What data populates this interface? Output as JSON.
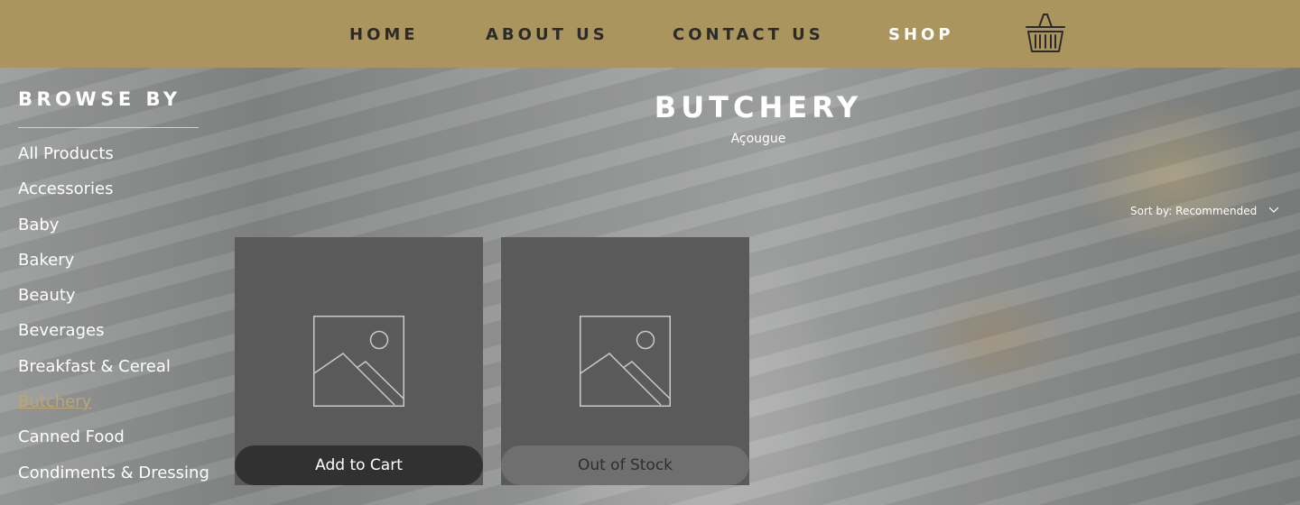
{
  "header": {
    "nav": [
      {
        "label": "HOME"
      },
      {
        "label": "ABOUT US"
      },
      {
        "label": "CONTACT US"
      },
      {
        "label": "SHOP",
        "active": true
      }
    ],
    "cart_icon": "basket-icon"
  },
  "sidebar": {
    "title": "BROWSE BY",
    "items": [
      {
        "label": "All Products"
      },
      {
        "label": "Accessories"
      },
      {
        "label": "Baby"
      },
      {
        "label": "Bakery"
      },
      {
        "label": "Beauty"
      },
      {
        "label": "Beverages"
      },
      {
        "label": "Breakfast & Cereal"
      },
      {
        "label": "Butchery",
        "active": true
      },
      {
        "label": "Canned Food"
      },
      {
        "label": "Condiments & Dressing"
      }
    ]
  },
  "main": {
    "title": "BUTCHERY",
    "subtitle": "Açougue",
    "sort": {
      "prefix": "Sort by:",
      "value": "Recommended"
    },
    "products": [
      {
        "image_icon": "image-placeholder-icon",
        "button_label": "Add to Cart"
      },
      {
        "image_icon": "image-placeholder-icon",
        "button_label": "Out of Stock"
      }
    ]
  },
  "colors": {
    "header_bg": "#ab955f",
    "active_category": "#bca672",
    "card_bg": "#5a5a5a",
    "add_button": "#313131",
    "out_of_stock_button": "#6f6f6f"
  }
}
